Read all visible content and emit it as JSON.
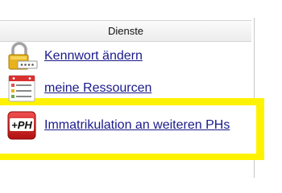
{
  "panel": {
    "header": "Dienste",
    "items": [
      {
        "label": "Kennwort ändern",
        "icon": "lock-password-icon"
      },
      {
        "label": "meine Ressourcen",
        "icon": "resources-list-icon"
      },
      {
        "label": "Immatrikulation an weiteren PHs",
        "icon": "plus-ph-icon",
        "icon_text": "+PH"
      }
    ]
  },
  "colors": {
    "link": "#1a1a8c",
    "highlight": "#fff200",
    "header_bg": "#eeeeee",
    "ph_icon": "#d42020"
  }
}
